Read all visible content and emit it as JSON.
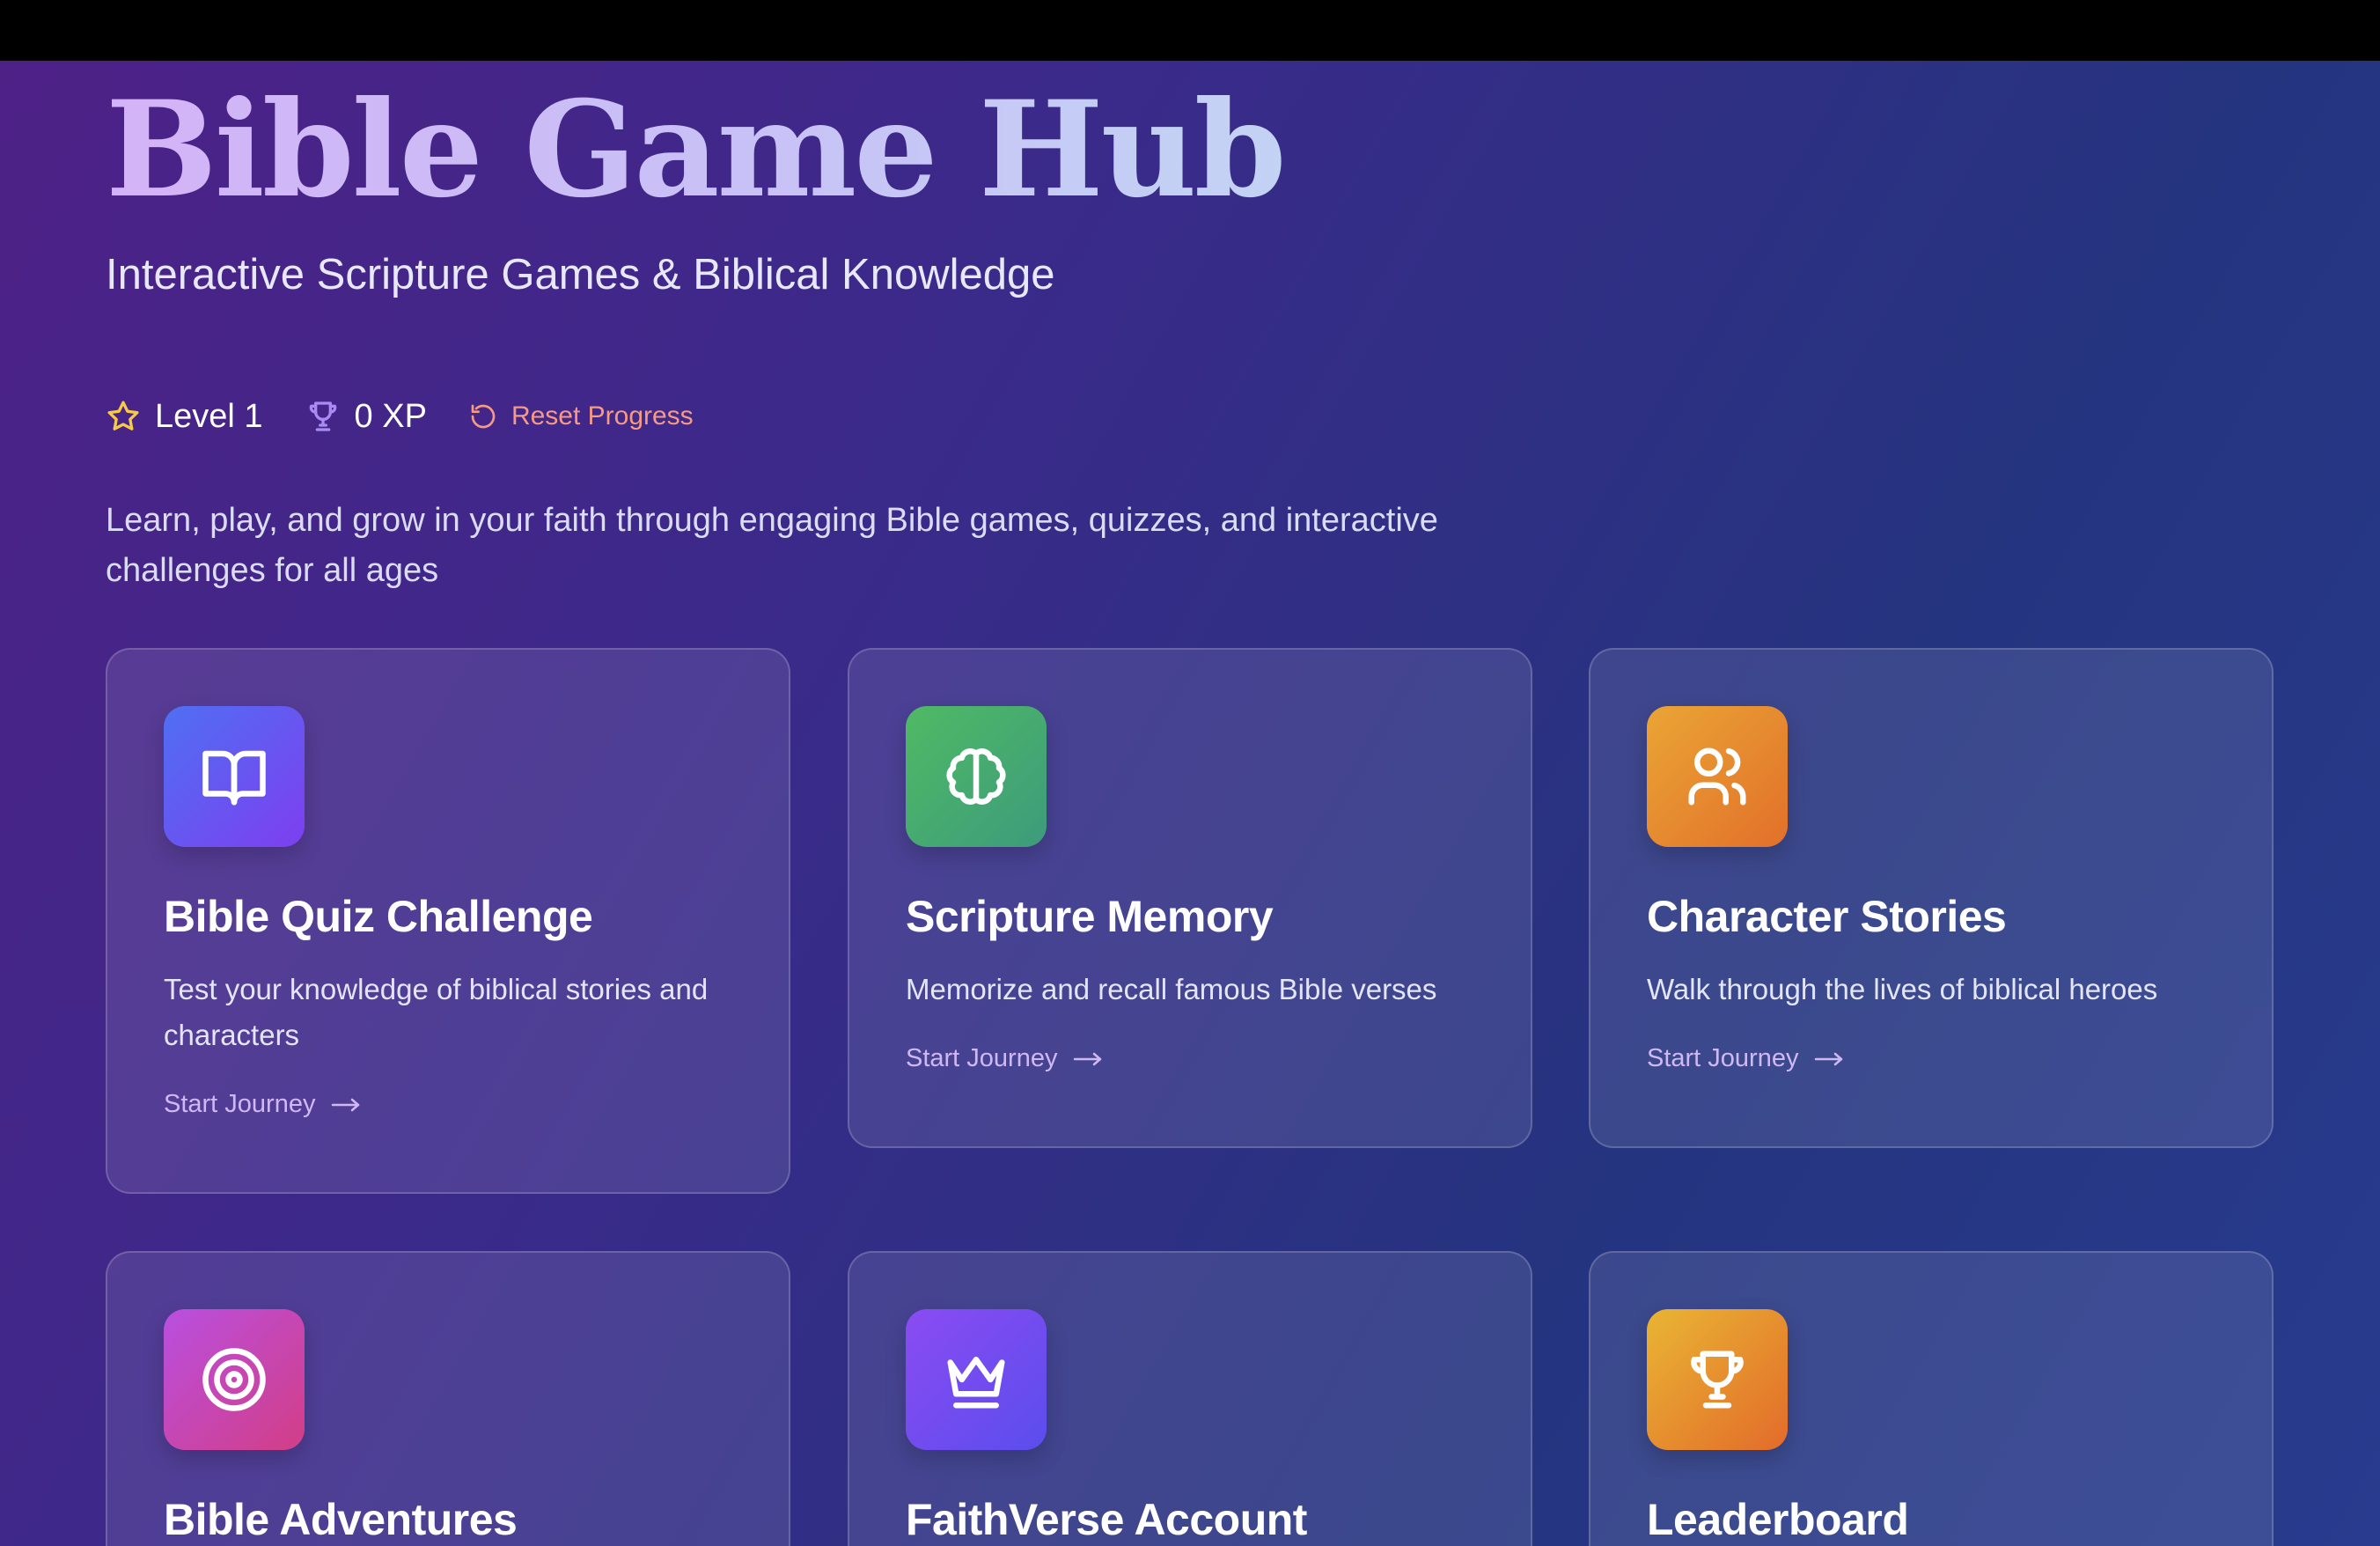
{
  "header": {
    "title": "Bible Game Hub",
    "subtitle": "Interactive Scripture Games & Biblical Knowledge"
  },
  "stats": {
    "level": "Level 1",
    "xp": "0 XP",
    "reset": "Reset Progress"
  },
  "description": "Learn, play, and grow in your faith through engaging Bible games, quizzes, and interactive challenges for all ages",
  "cards": [
    {
      "title": "Bible Quiz Challenge",
      "description": "Test your knowledge of biblical stories and characters",
      "cta": "Start Journey",
      "icon": "book-open-icon",
      "gradient": [
        "#4f6ff2",
        "#7e3ff0"
      ]
    },
    {
      "title": "Scripture Memory",
      "description": "Memorize and recall famous Bible verses",
      "cta": "Start Journey",
      "icon": "brain-icon",
      "gradient": [
        "#4fba64",
        "#3d9b7c"
      ]
    },
    {
      "title": "Character Stories",
      "description": "Walk through the lives of biblical heroes",
      "cta": "Start Journey",
      "icon": "users-icon",
      "gradient": [
        "#eaa535",
        "#e2702a"
      ]
    },
    {
      "title": "Bible Adventures",
      "description": "",
      "cta": "",
      "icon": "target-icon",
      "gradient": [
        "#b94fe0",
        "#d33e86"
      ]
    },
    {
      "title": "FaithVerse Account",
      "description": "",
      "cta": "",
      "icon": "crown-icon",
      "gradient": [
        "#8a4cf2",
        "#5b4ded"
      ]
    },
    {
      "title": "Leaderboard",
      "description": "",
      "cta": "",
      "icon": "trophy-icon",
      "gradient": [
        "#e9b534",
        "#e36b2a"
      ]
    }
  ],
  "colors": {
    "accent_purple": "#d0b8f5",
    "reset_coral": "#f59a84",
    "star_yellow": "#f7c948",
    "trophy_purple": "#a98bf3"
  }
}
